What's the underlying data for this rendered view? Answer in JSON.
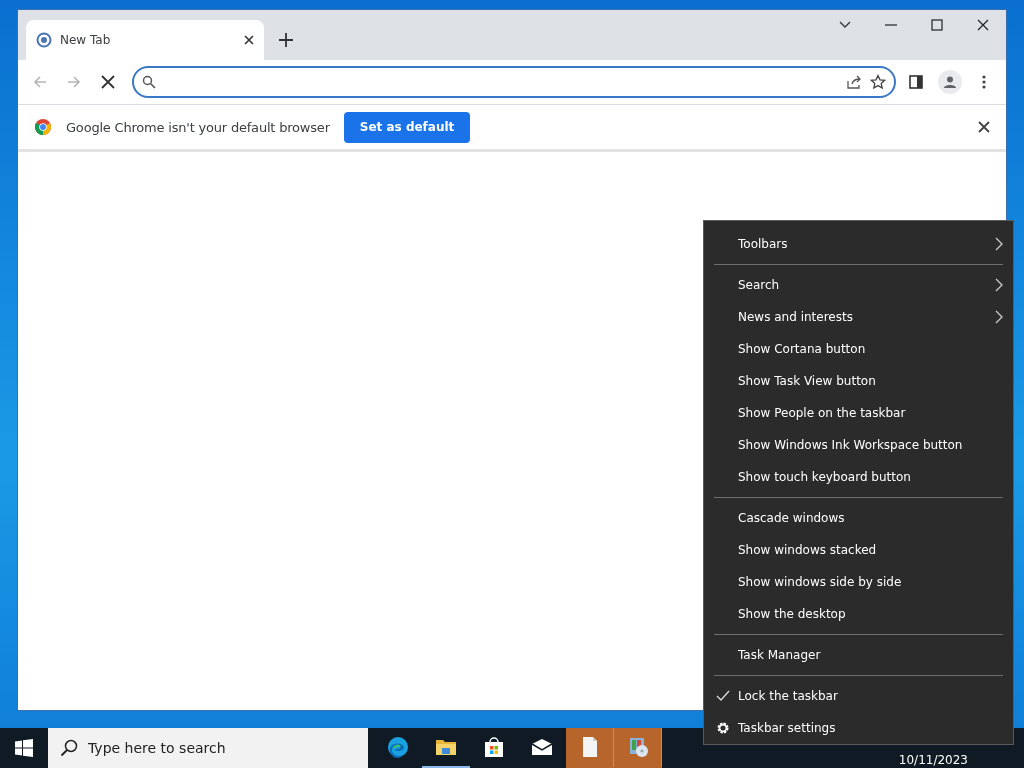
{
  "browser": {
    "tabs": [
      {
        "title": "New Tab",
        "selected": true
      }
    ],
    "loading": true,
    "infobar": {
      "message": "Google Chrome isn't your default browser",
      "button": "Set as default"
    }
  },
  "context_menu": {
    "groups": [
      [
        {
          "label": "Toolbars",
          "kind": "submenu"
        }
      ],
      [
        {
          "label": "Search",
          "kind": "submenu"
        },
        {
          "label": "News and interests",
          "kind": "submenu"
        },
        {
          "label": "Show Cortana button",
          "kind": "command"
        },
        {
          "label": "Show Task View button",
          "kind": "command"
        },
        {
          "label": "Show People on the taskbar",
          "kind": "command"
        },
        {
          "label": "Show Windows Ink Workspace button",
          "kind": "command"
        },
        {
          "label": "Show touch keyboard button",
          "kind": "command"
        }
      ],
      [
        {
          "label": "Cascade windows",
          "kind": "command"
        },
        {
          "label": "Show windows stacked",
          "kind": "command"
        },
        {
          "label": "Show windows side by side",
          "kind": "command"
        },
        {
          "label": "Show the desktop",
          "kind": "command"
        }
      ],
      [
        {
          "label": "Task Manager",
          "kind": "command"
        }
      ],
      [
        {
          "label": "Lock the taskbar",
          "kind": "toggle",
          "checked": true
        },
        {
          "label": "Taskbar settings",
          "kind": "settings"
        }
      ]
    ]
  },
  "taskbar": {
    "search": {
      "placeholder": "Type here to search"
    },
    "apps": [
      {
        "kind": "edge",
        "active": false,
        "flashing": false
      },
      {
        "kind": "folder",
        "active": true,
        "flashing": false
      },
      {
        "kind": "store",
        "active": false,
        "flashing": false
      },
      {
        "kind": "mail",
        "active": false,
        "flashing": false
      },
      {
        "kind": "document",
        "active": false,
        "flashing": true
      },
      {
        "kind": "installer",
        "active": false,
        "flashing": true
      }
    ],
    "date": "10/11/2023"
  }
}
